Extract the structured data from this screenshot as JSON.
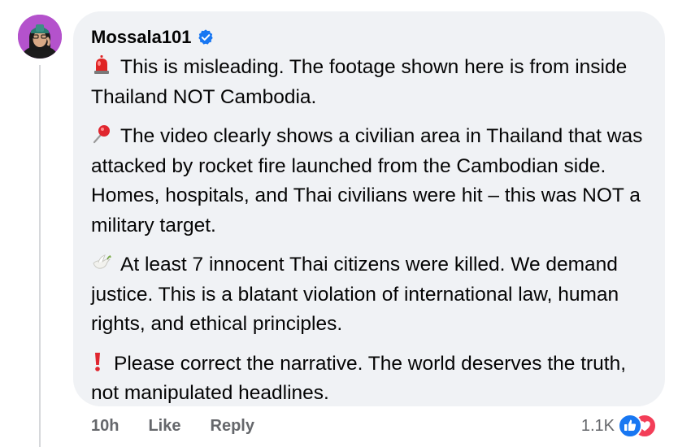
{
  "comment": {
    "author": "Mossala101",
    "verified": true,
    "paragraphs": [
      {
        "emoji": "siren-icon",
        "text": "This is misleading. The footage shown here is from inside Thailand NOT Cambodia."
      },
      {
        "emoji": "round-pushpin-icon",
        "text": "The video clearly shows a civilian area in Thailand that was attacked by rocket fire launched from the Cambodian side. Homes, hospitals, and Thai civilians were hit – this was NOT a military target."
      },
      {
        "emoji": "dove-icon",
        "text": "At least 7 innocent Thai citizens were killed. We demand justice. This is a blatant violation of international law, human rights, and ethical principles."
      },
      {
        "emoji": "red-exclamation-icon",
        "text": "Please correct the narrative. The world deserves the truth, not manipulated headlines."
      }
    ]
  },
  "actions": {
    "time": "10h",
    "like": "Like",
    "reply": "Reply"
  },
  "reactions": {
    "count": "1.1K",
    "types": [
      "like-reaction-icon",
      "love-reaction-icon"
    ]
  },
  "colors": {
    "bubble": "#f0f2f5",
    "verified": "#1877f2",
    "meta_text": "#65676b",
    "like": "#1877f2",
    "love": "#f33e58"
  }
}
